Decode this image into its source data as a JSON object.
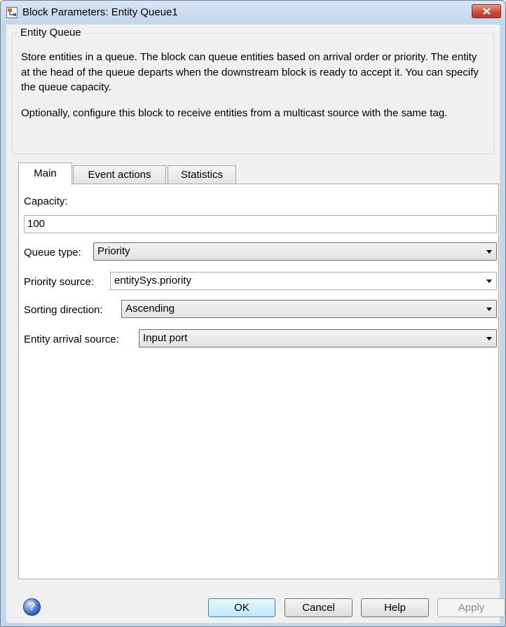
{
  "window": {
    "title": "Block Parameters: Entity Queue1"
  },
  "description": {
    "group_title": "Entity Queue",
    "paragraph_1": "Store entities in a queue. The block can queue entities based on arrival order or priority. The entity at the head of the queue departs when the downstream block is ready to accept it. You can specify the queue capacity.",
    "paragraph_2": "Optionally, configure this block to receive entities from a multicast source with the same tag."
  },
  "tabs": [
    {
      "label": "Main",
      "active": true
    },
    {
      "label": "Event actions",
      "active": false
    },
    {
      "label": "Statistics",
      "active": false
    }
  ],
  "main": {
    "capacity": {
      "label": "Capacity:",
      "value": "100"
    },
    "queue_type": {
      "label": "Queue type:",
      "value": "Priority"
    },
    "priority_source": {
      "label": "Priority source:",
      "value": "entitySys.priority"
    },
    "sorting_direction": {
      "label": "Sorting direction:",
      "value": "Ascending"
    },
    "entity_arrival_source": {
      "label": "Entity arrival source:",
      "value": "Input port"
    }
  },
  "buttons": {
    "ok": "OK",
    "cancel": "Cancel",
    "help": "Help",
    "apply": "Apply"
  },
  "icons": {
    "help": "help-icon",
    "close": "close-icon",
    "app": "simulink-block-icon"
  },
  "colors": {
    "close_button": "#c9503e",
    "frame": "#c4d6ea",
    "default_button": "#bee6fd"
  }
}
